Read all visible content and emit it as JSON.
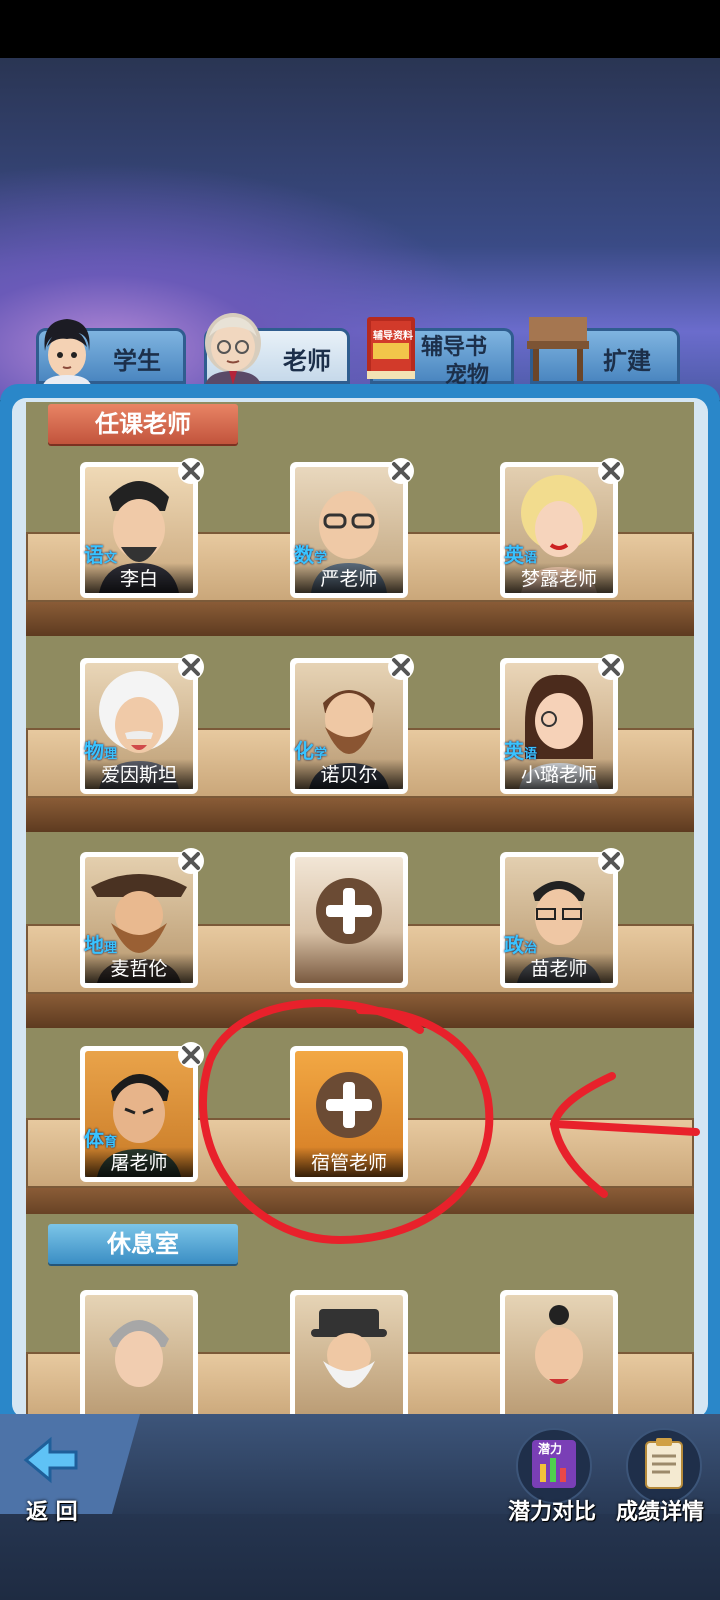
{
  "tabs": [
    {
      "label": "学生"
    },
    {
      "label": "老师"
    },
    {
      "label_line1": "辅导书",
      "label_line2": "宠物",
      "book_text": "辅导资料"
    },
    {
      "label": "扩建"
    }
  ],
  "sections": {
    "teachers_title": "任课老师",
    "lounge_title": "休息室"
  },
  "teachers": [
    {
      "name": "李白",
      "subject": "语",
      "subject_small": "文"
    },
    {
      "name": "严老师",
      "subject": "数",
      "subject_small": "学"
    },
    {
      "name": "梦露老师",
      "subject": "英",
      "subject_small": "语"
    },
    {
      "name": "爱因斯坦",
      "subject": "物",
      "subject_small": "理"
    },
    {
      "name": "诺贝尔",
      "subject": "化",
      "subject_small": "学"
    },
    {
      "name": "小璐老师",
      "subject": "英",
      "subject_small": "语"
    },
    {
      "name": "麦哲伦",
      "subject": "地",
      "subject_small": "理"
    },
    {
      "name": "苗老师",
      "subject": "政",
      "subject_small": "治"
    },
    {
      "name": "屠老师",
      "subject": "体",
      "subject_small": "育"
    }
  ],
  "empty_slot_label": "宿管老师",
  "bottom": {
    "back_label": "返 回",
    "compare_label": "潜力对比",
    "compare_icon_text": "潜力",
    "scores_label": "成绩详情"
  },
  "colors": {
    "annotation": "#e8212b",
    "panel_blue": "#2a87c9",
    "subject_cyan": "#39c3ff"
  }
}
